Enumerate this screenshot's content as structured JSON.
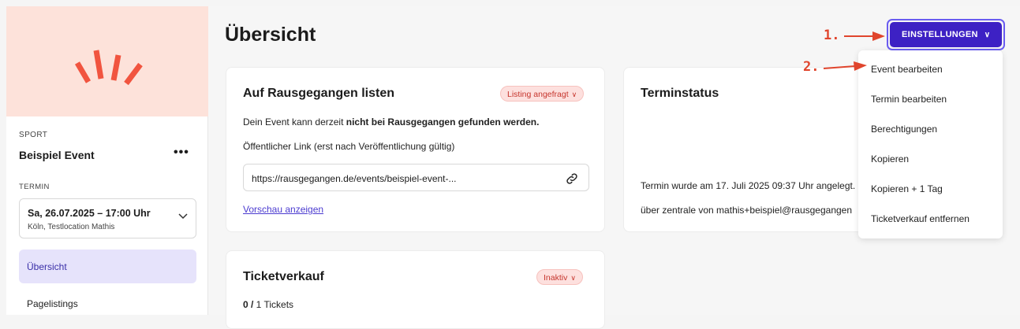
{
  "sidebar": {
    "category": "SPORT",
    "event_name": "Beispiel Event",
    "more": "•••",
    "termin_label": "TERMIN",
    "date": "Sa, 26.07.2025 – 17:00 Uhr",
    "location": "Köln, Testlocation Mathis",
    "nav": [
      {
        "label": "Übersicht",
        "active": true
      },
      {
        "label": "Pagelistings",
        "active": false
      }
    ]
  },
  "main": {
    "title": "Übersicht",
    "listing_card": {
      "title": "Auf Rausgegangen listen",
      "badge": "Listing angefragt",
      "text_start": "Dein Event kann derzeit ",
      "text_bold": "nicht bei Rausgegangen gefunden werden.",
      "link_label": "Öffentlicher Link (erst nach Veröffentlichung gültig)",
      "link_value": "https://rausgegangen.de/events/beispiel-event-...",
      "preview_link": "Vorschau anzeigen"
    },
    "status_card": {
      "title": "Terminstatus",
      "created_text": "Termin wurde am 17. Juli 2025 09:37 Uhr angelegt.",
      "by_text": "über zentrale von mathis+beispiel@rausgegangen"
    },
    "ticket_card": {
      "title": "Ticketverkauf",
      "badge": "Inaktiv",
      "count_bold": "0 /",
      "count_rest": " 1 Tickets"
    }
  },
  "settings": {
    "button_label": "EINSTELLUNGEN",
    "menu_items": [
      "Event bearbeiten",
      "Termin bearbeiten",
      "Berechtigungen",
      "Kopieren",
      "Kopieren + 1 Tag",
      "Ticketverkauf entfernen"
    ]
  },
  "annotations": {
    "step1": "1.",
    "step2": "2."
  },
  "colors": {
    "accent": "#3d21c4",
    "hero": "#fde2da",
    "annotation": "#e0452d",
    "badge_bg": "#fde0de"
  }
}
